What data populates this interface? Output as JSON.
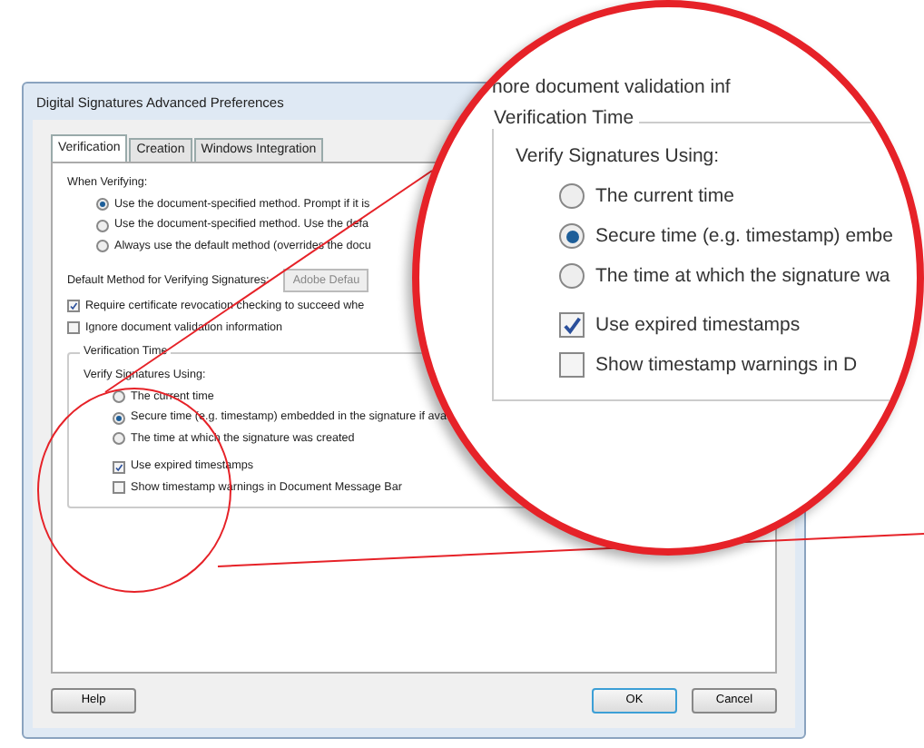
{
  "dialog": {
    "title": "Digital Signatures Advanced Preferences",
    "tabs": [
      {
        "label": "Verification",
        "selected": true
      },
      {
        "label": "Creation",
        "selected": false
      },
      {
        "label": "Windows Integration",
        "selected": false
      }
    ],
    "when_verifying": {
      "label": "When Verifying:",
      "options": [
        {
          "label": "Use the document-specified method. Prompt if it is",
          "selected": true
        },
        {
          "label": "Use the document-specified method. Use the defa",
          "selected": false
        },
        {
          "label": "Always use the default method (overrides the docu",
          "selected": false
        }
      ]
    },
    "default_method": {
      "label": "Default Method for Verifying Signatures:",
      "value": "Adobe Defau"
    },
    "checks": [
      {
        "label": "Require certificate revocation checking to succeed whe",
        "checked": true
      },
      {
        "label": "Ignore document validation information",
        "checked": false
      }
    ],
    "verification_time": {
      "title": "Verification Time",
      "label": "Verify Signatures Using:",
      "options": [
        {
          "label": "The current time",
          "selected": false
        },
        {
          "label": "Secure time (e.g. timestamp) embedded in the signature if ava",
          "selected": true
        },
        {
          "label": "The time at which the signature was created",
          "selected": false
        }
      ],
      "checks": [
        {
          "label": "Use expired timestamps",
          "checked": true
        },
        {
          "label": "Show timestamp warnings in Document Message Bar",
          "checked": false
        }
      ]
    },
    "buttons": [
      {
        "label": "Help",
        "kind": "help",
        "default": false
      },
      {
        "label": "OK",
        "kind": "ok",
        "default": true
      },
      {
        "label": "Cancel",
        "kind": "cancel",
        "default": false
      }
    ]
  },
  "magnifier": {
    "partial_line": "nore document validation inf",
    "title": "Verification Time",
    "label": "Verify Signatures Using:",
    "options": [
      {
        "label": "The current time",
        "selected": false
      },
      {
        "label": "Secure time (e.g. timestamp) embe",
        "selected": true
      },
      {
        "label": "The time at which the signature wa",
        "selected": false
      }
    ],
    "checks": [
      {
        "label": "Use expired timestamps",
        "checked": true
      },
      {
        "label": "Show timestamp warnings in D",
        "checked": false
      }
    ]
  }
}
